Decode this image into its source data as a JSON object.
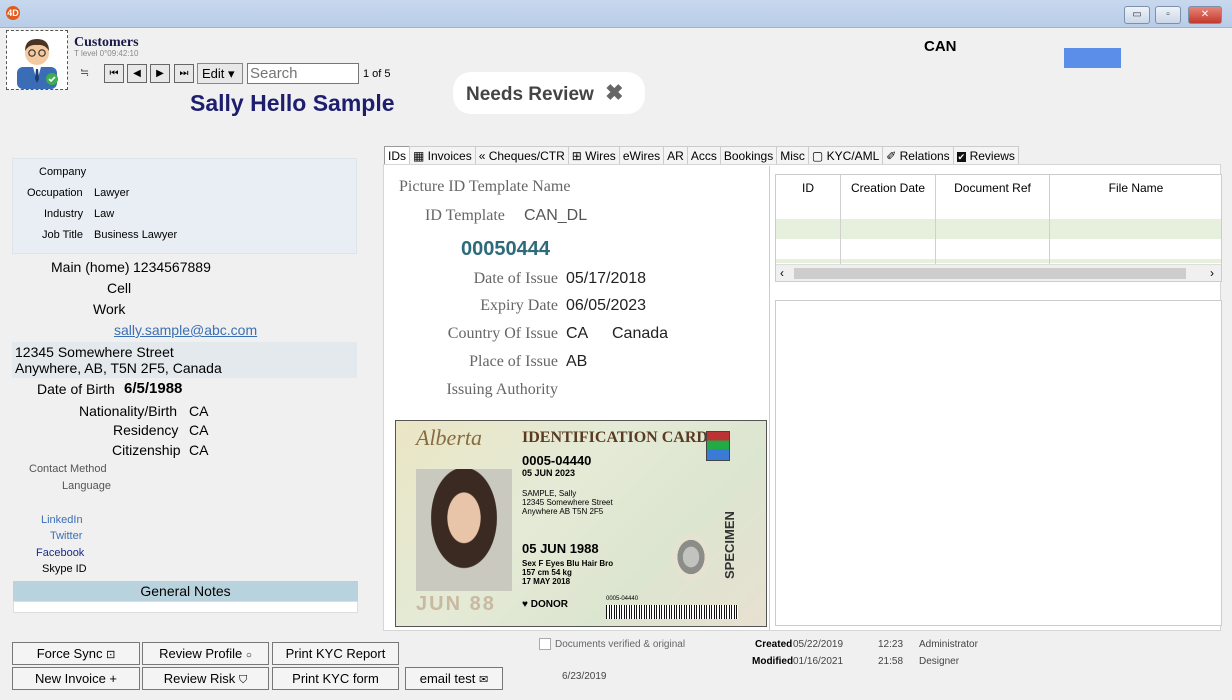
{
  "window": {
    "app_icon": "4D",
    "minimize": "▭",
    "maximize": "▫",
    "close": "✕"
  },
  "header": {
    "module_title": "Customers",
    "module_sub": "T level 0°09:42:10",
    "edit_label": "Edit ▾",
    "search_placeholder": "Search",
    "record_count": "1 of 5",
    "customer_name": "Sally Hello Sample",
    "needs_review_label": "Needs Review",
    "country_code": "CAN"
  },
  "left": {
    "company_label": "Company",
    "occupation_label": "Occupation",
    "occupation_value": "Lawyer",
    "industry_label": "Industry",
    "industry_value": "Law",
    "job_title_label": "Job Title",
    "job_title_value": "Business Lawyer",
    "main_label": "Main (home)",
    "main_value": "1234567889",
    "cell_label": "Cell",
    "work_label": "Work",
    "email": "sally.sample@abc.com",
    "address_line1": "12345 Somewhere Street",
    "address_line2": "Anywhere, AB, T5N 2F5, Canada",
    "dob_label": "Date of Birth",
    "dob_value": "6/5/1988",
    "nationality_label": "Nationality/Birth",
    "nationality_value": "CA",
    "residency_label": "Residency",
    "residency_value": "CA",
    "citizenship_label": "Citizenship",
    "citizenship_value": "CA",
    "contact_method_label": "Contact Method",
    "language_label": "Language",
    "linkedin_label": "LinkedIn",
    "twitter_label": "Twitter",
    "facebook_label": "Facebook",
    "skype_label": "Skype ID",
    "notes_header": "General Notes"
  },
  "tabs": [
    "IDs",
    "Invoices",
    "Cheques/CTR",
    "Wires",
    "eWires",
    "AR",
    "Accs",
    "Bookings",
    "Misc",
    "KYC/AML",
    "Relations",
    "Reviews"
  ],
  "ids": {
    "picture_template_label": "Picture ID Template Name",
    "id_template_label": "ID Template",
    "id_template_value": "CAN_DL",
    "id_number": "00050444",
    "issue_label": "Date of Issue",
    "issue_value": "05/17/2018",
    "expiry_label": "Expiry Date",
    "expiry_value": "06/05/2023",
    "country_label": "Country Of Issue",
    "country_code": "CA",
    "country_name": "Canada",
    "place_label": "Place of Issue",
    "place_value": "AB",
    "authority_label": "Issuing Authority"
  },
  "card": {
    "province": "Alberta",
    "title": "IDENTIFICATION CARD",
    "number": "0005-04440",
    "exp": "05 JUN 2023",
    "name": "SAMPLE, Sally",
    "addr1": "12345 Somewhere Street",
    "addr2": "Anywhere AB  T5N 2F5",
    "dob": "05 JUN 1988",
    "sex": "F",
    "eyes": "Blu",
    "hair": "Bro",
    "height": "157 cm",
    "weight": "54 kg",
    "issued": "17 MAY 2018",
    "specimen": "SPECIMEN",
    "donor": "DONOR",
    "small_num": "0005-04440",
    "ghost_dob": "JUN 88"
  },
  "grid": {
    "columns": [
      "ID",
      "Creation Date",
      "Document Ref",
      "File Name"
    ]
  },
  "footer": {
    "force_sync": "Force Sync",
    "review_profile": "Review Profile",
    "print_kyc_report": "Print KYC Report",
    "new_invoice": "New Invoice +",
    "review_risk": "Review Risk",
    "print_kyc_form": "Print KYC form",
    "email_test": "email test",
    "docs_verified_label": "Documents verified & original",
    "date": "6/23/2019",
    "created_label": "Created",
    "created_date": "05/22/2019",
    "created_time": "12:23",
    "created_by": "Administrator",
    "modified_label": "Modified",
    "modified_date": "01/16/2021",
    "modified_time": "21:58",
    "modified_by": "Designer"
  }
}
